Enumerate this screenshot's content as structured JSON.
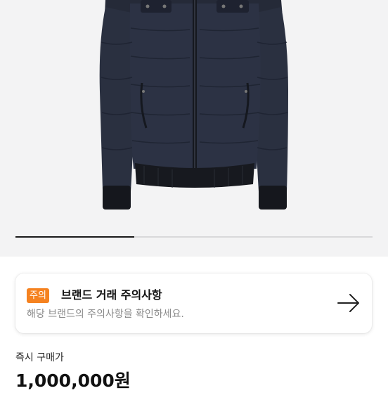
{
  "product": {
    "image_alt": "navy down bomber jacket",
    "carousel": {
      "current": 1,
      "total": 3
    }
  },
  "notice": {
    "badge": "주의",
    "title": "브랜드 거래 주의사항",
    "subtitle": "해당 브랜드의 주의사항을 확인하세요.",
    "arrow_icon": "arrow-right-icon",
    "badge_color": "#f58220"
  },
  "buy": {
    "label": "즉시 구매가",
    "price": "1,000,000원"
  }
}
